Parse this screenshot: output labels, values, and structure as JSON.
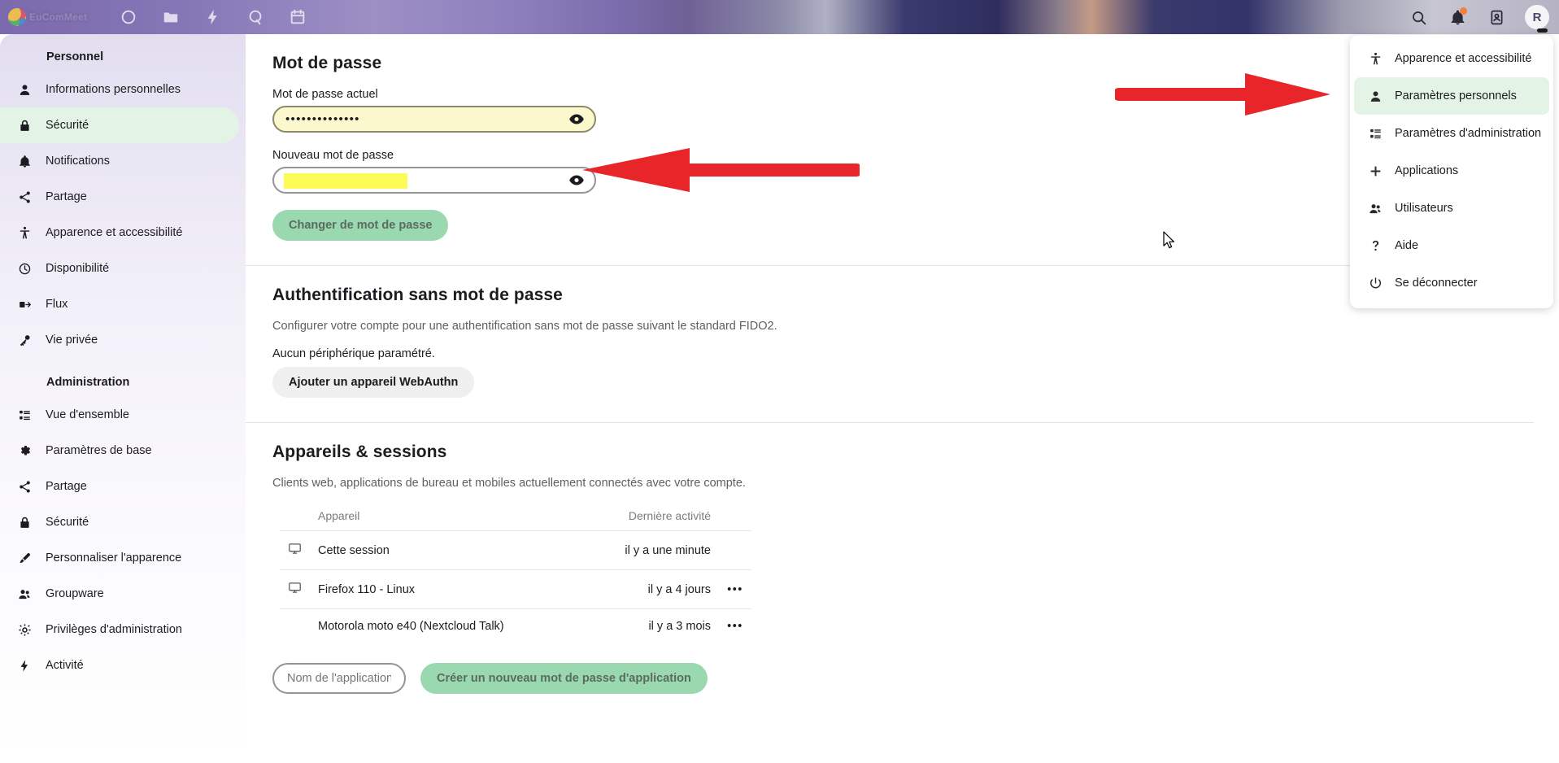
{
  "header": {
    "logo_text": "EuComMeet",
    "nav_icons": [
      "dashboard-icon",
      "files-icon",
      "activity-icon",
      "talk-icon",
      "calendar-icon"
    ],
    "right_icons": [
      "search-icon",
      "notifications-icon",
      "contacts-icon"
    ],
    "avatar_initial": "R"
  },
  "sidebar": {
    "groups": [
      {
        "title": "Personnel",
        "items": [
          {
            "label": "Informations personnelles",
            "icon": "user-icon",
            "active": false
          },
          {
            "label": "Sécurité",
            "icon": "lock-icon",
            "active": true
          },
          {
            "label": "Notifications",
            "icon": "bell-icon",
            "active": false
          },
          {
            "label": "Partage",
            "icon": "share-icon",
            "active": false
          },
          {
            "label": "Apparence et accessibilité",
            "icon": "accessibility-icon",
            "active": false
          },
          {
            "label": "Disponibilité",
            "icon": "clock-icon",
            "active": false
          },
          {
            "label": "Flux",
            "icon": "rss-icon",
            "active": false
          },
          {
            "label": "Vie privée",
            "icon": "key-icon",
            "active": false
          }
        ]
      },
      {
        "title": "Administration",
        "items": [
          {
            "label": "Vue d'ensemble",
            "icon": "list-icon",
            "active": false
          },
          {
            "label": "Paramètres de base",
            "icon": "gear-icon",
            "active": false
          },
          {
            "label": "Partage",
            "icon": "share-icon",
            "active": false
          },
          {
            "label": "Sécurité",
            "icon": "lock-icon",
            "active": false
          },
          {
            "label": "Personnaliser l'apparence",
            "icon": "brush-icon",
            "active": false
          },
          {
            "label": "Groupware",
            "icon": "group-icon",
            "active": false
          },
          {
            "label": "Privilèges d'administration",
            "icon": "admin-gear-icon",
            "active": false
          },
          {
            "label": "Activité",
            "icon": "lightning-icon",
            "active": false
          }
        ]
      }
    ]
  },
  "main": {
    "password_section": {
      "title": "Mot de passe",
      "current_label": "Mot de passe actuel",
      "current_value": "••••••••••••••",
      "new_label": "Nouveau mot de passe",
      "new_value": "",
      "submit_label": "Changer de mot de passe"
    },
    "webauthn_section": {
      "title": "Authentification sans mot de passe",
      "description": "Configurer votre compte pour une authentification sans mot de passe suivant le standard FIDO2.",
      "no_device": "Aucun périphérique paramétré.",
      "add_button": "Ajouter un appareil WebAuthn"
    },
    "sessions_section": {
      "title": "Appareils & sessions",
      "description": "Clients web, applications de bureau et mobiles actuellement connectés avec votre compte.",
      "columns": [
        "Appareil",
        "Dernière activité"
      ],
      "rows": [
        {
          "device": "Cette session",
          "icon": "monitor-icon",
          "activity": "il y a une minute",
          "menu": ""
        },
        {
          "device": "Firefox 110 - Linux",
          "icon": "monitor-icon",
          "activity": "il y a 4 jours",
          "menu": "•••"
        },
        {
          "device": "Motorola moto e40 (Nextcloud Talk)",
          "icon": "",
          "activity": "il y a 3 mois",
          "menu": "•••"
        }
      ],
      "app_name_placeholder": "Nom de l'application",
      "app_name_value": "",
      "create_button": "Créer un nouveau mot de passe d'application"
    }
  },
  "user_menu": {
    "items": [
      {
        "label": "Apparence et accessibilité",
        "icon": "accessibility-icon",
        "highlight": false
      },
      {
        "label": "Paramètres personnels",
        "icon": "user-icon",
        "highlight": true
      },
      {
        "label": "Paramètres d'administration",
        "icon": "list-icon",
        "highlight": false
      },
      {
        "label": "Applications",
        "icon": "plus-icon",
        "highlight": false
      },
      {
        "label": "Utilisateurs",
        "icon": "group-icon",
        "highlight": false
      },
      {
        "label": "Aide",
        "icon": "question-icon",
        "highlight": false
      },
      {
        "label": "Se déconnecter",
        "icon": "power-icon",
        "highlight": false
      }
    ]
  },
  "annotations": {
    "arrow_color": "#e8262a",
    "arrows": [
      {
        "name": "arrow-pointing-to-new-password-field",
        "direction": "left"
      },
      {
        "name": "arrow-pointing-to-personal-settings-menu-item",
        "direction": "right"
      }
    ]
  }
}
